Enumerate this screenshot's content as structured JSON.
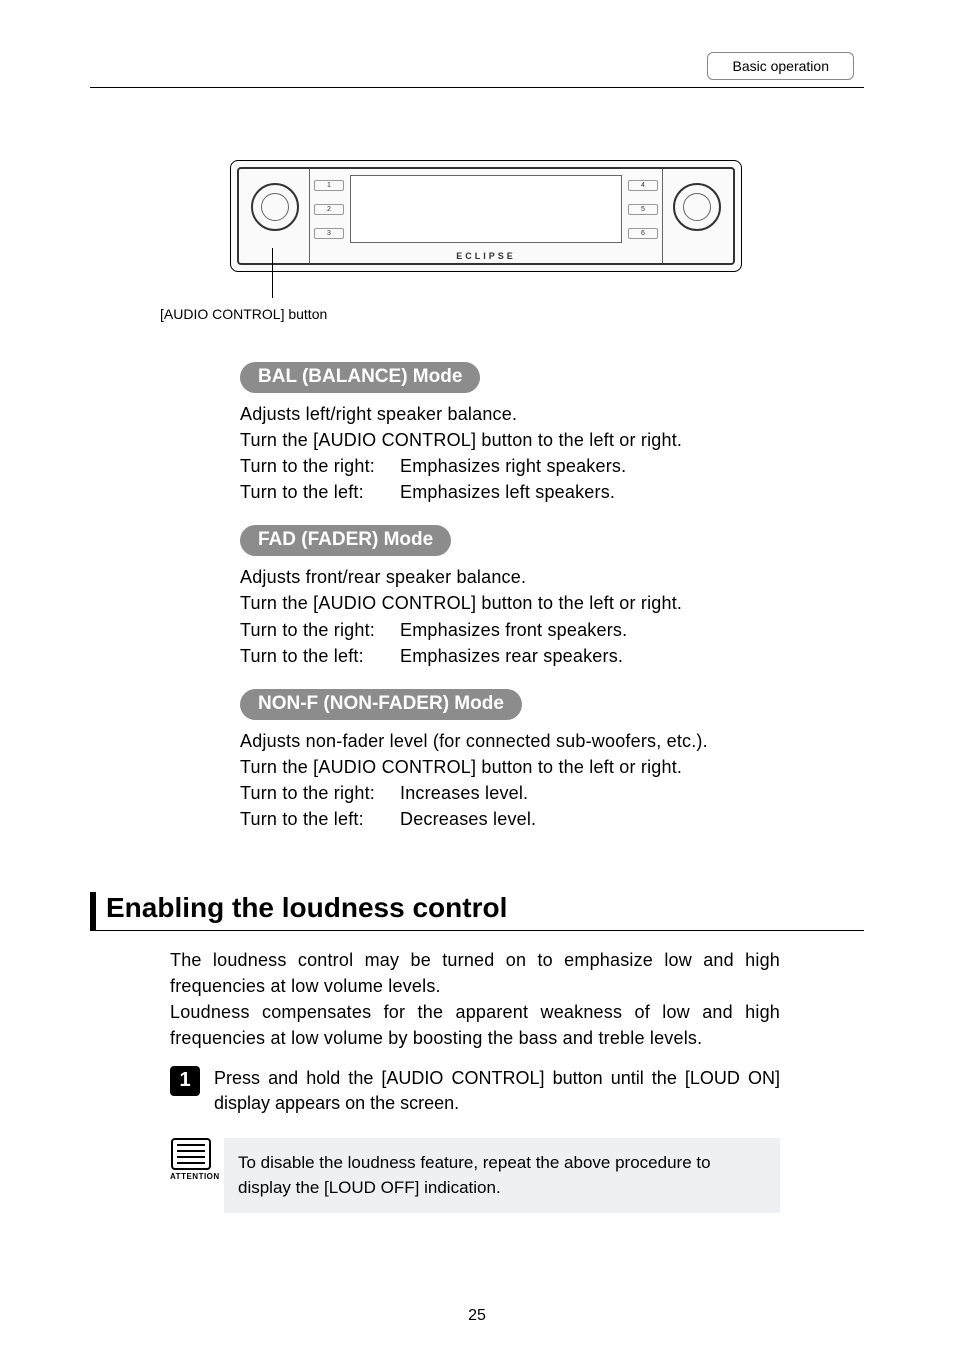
{
  "header": {
    "section": "Basic operation"
  },
  "diagram": {
    "callout": "[AUDIO CONTROL] button",
    "brand": "ECLIPSE",
    "left_nums": [
      "1",
      "2",
      "3"
    ],
    "right_nums": [
      "4",
      "5",
      "6"
    ]
  },
  "modes": {
    "bal": {
      "title": "BAL (BALANCE) Mode",
      "intro1": "Adjusts left/right speaker balance.",
      "intro2": "Turn the [AUDIO CONTROL] button to the left or right.",
      "right_label": "Turn to the right:",
      "right_text": "Emphasizes right speakers.",
      "left_label": "Turn to the left:",
      "left_text": "Emphasizes left speakers."
    },
    "fad": {
      "title": "FAD (FADER) Mode",
      "intro1": "Adjusts front/rear speaker balance.",
      "intro2": "Turn the [AUDIO CONTROL] button to the left or right.",
      "right_label": "Turn to the right:",
      "right_text": "Emphasizes front speakers.",
      "left_label": "Turn to the left:",
      "left_text": "Emphasizes rear speakers."
    },
    "nonf": {
      "title": "NON-F (NON-FADER) Mode",
      "intro1": "Adjusts non-fader level (for connected sub-woofers, etc.).",
      "intro2": "Turn the [AUDIO CONTROL] button to the left or right.",
      "right_label": "Turn to the right:",
      "right_text": "Increases level.",
      "left_label": "Turn to the left:",
      "left_text": "Decreases level."
    }
  },
  "loudness": {
    "heading": "Enabling the loudness control",
    "para1": "The loudness control may be turned on to emphasize low and high frequencies at low volume levels.",
    "para2": "Loudness compensates for the apparent weakness of low and high frequencies at low volume by boosting the bass and treble levels.",
    "step_num": "1",
    "step_text": "Press and hold the [AUDIO CONTROL] button until the [LOUD ON] display appears on the screen.",
    "attention_label": "ATTENTION",
    "attention_text": "To disable the loudness feature, repeat the above procedure to display the [LOUD OFF] indication."
  },
  "page_number": "25"
}
